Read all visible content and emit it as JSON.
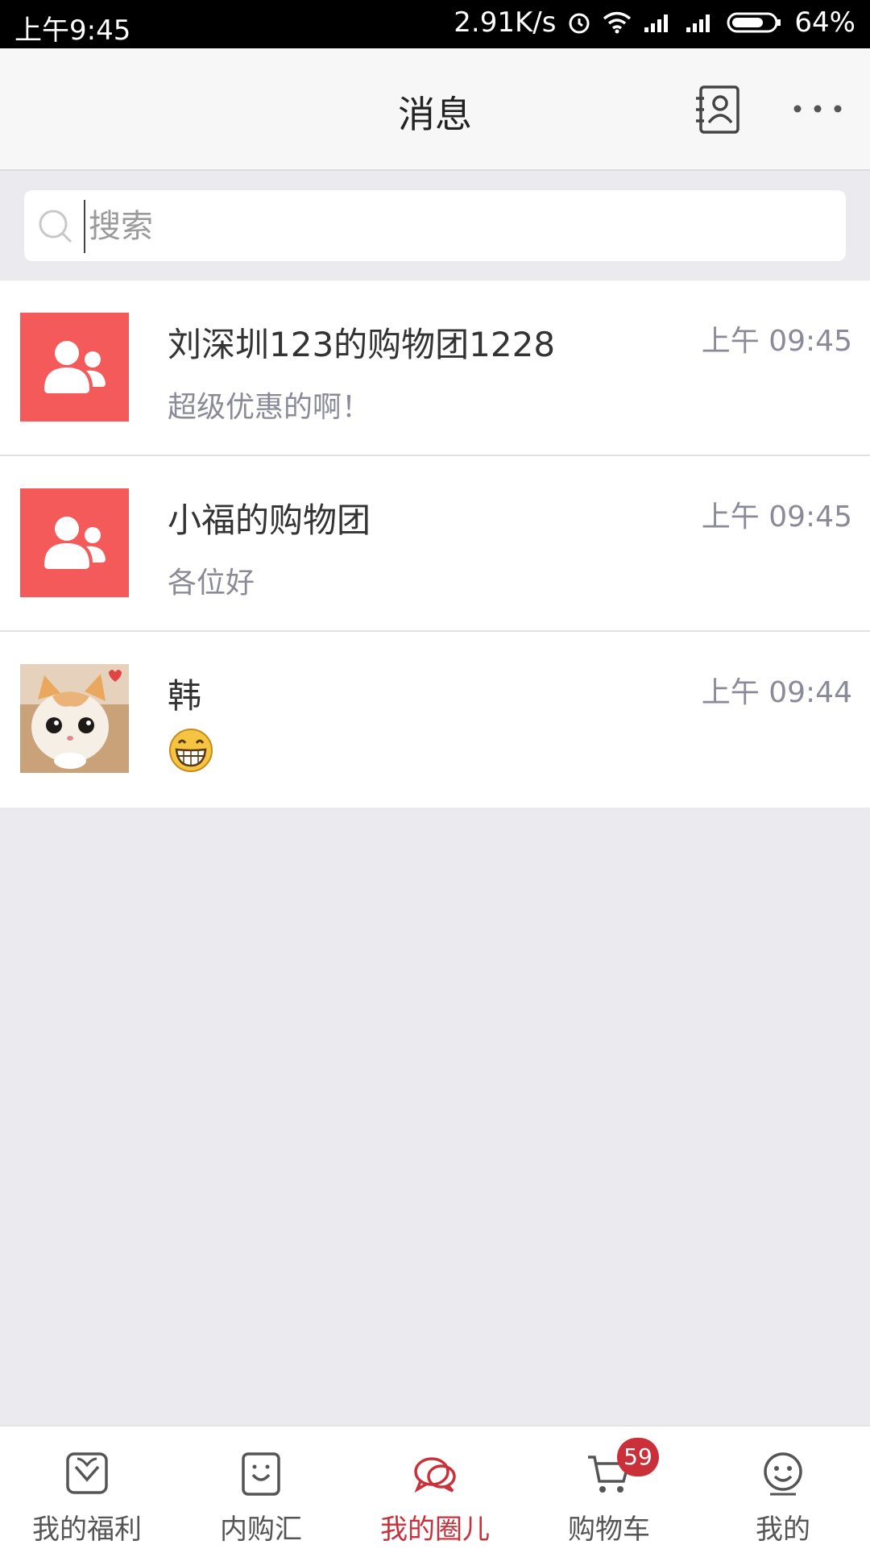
{
  "status_bar": {
    "time": "上午9:45",
    "network_speed": "2.91K/s",
    "battery": "64%"
  },
  "header": {
    "title": "消息"
  },
  "search": {
    "placeholder": "搜索",
    "value": ""
  },
  "chats": [
    {
      "name": "刘深圳123的购物团1228",
      "time": "上午 09:45",
      "preview": "超级优惠的啊！",
      "avatar": "group-icon"
    },
    {
      "name": "小福的购物团",
      "time": "上午 09:45",
      "preview": "各位好",
      "avatar": "group-icon"
    },
    {
      "name": "韩",
      "time": "上午 09:44",
      "preview_icon": "grinning-emoji",
      "avatar": "cat-photo"
    }
  ],
  "tabs": [
    {
      "label": "我的福利",
      "icon": "heart-bag-icon"
    },
    {
      "label": "内购汇",
      "icon": "shopping-bag-icon"
    },
    {
      "label": "我的圈儿",
      "icon": "chat-bubbles-icon",
      "active": true
    },
    {
      "label": "购物车",
      "icon": "cart-icon",
      "badge": "59"
    },
    {
      "label": "我的",
      "icon": "smiley-icon"
    }
  ],
  "colors": {
    "accent": "#c9303a",
    "group_avatar": "#f55a5a",
    "background": "#ebebef"
  }
}
